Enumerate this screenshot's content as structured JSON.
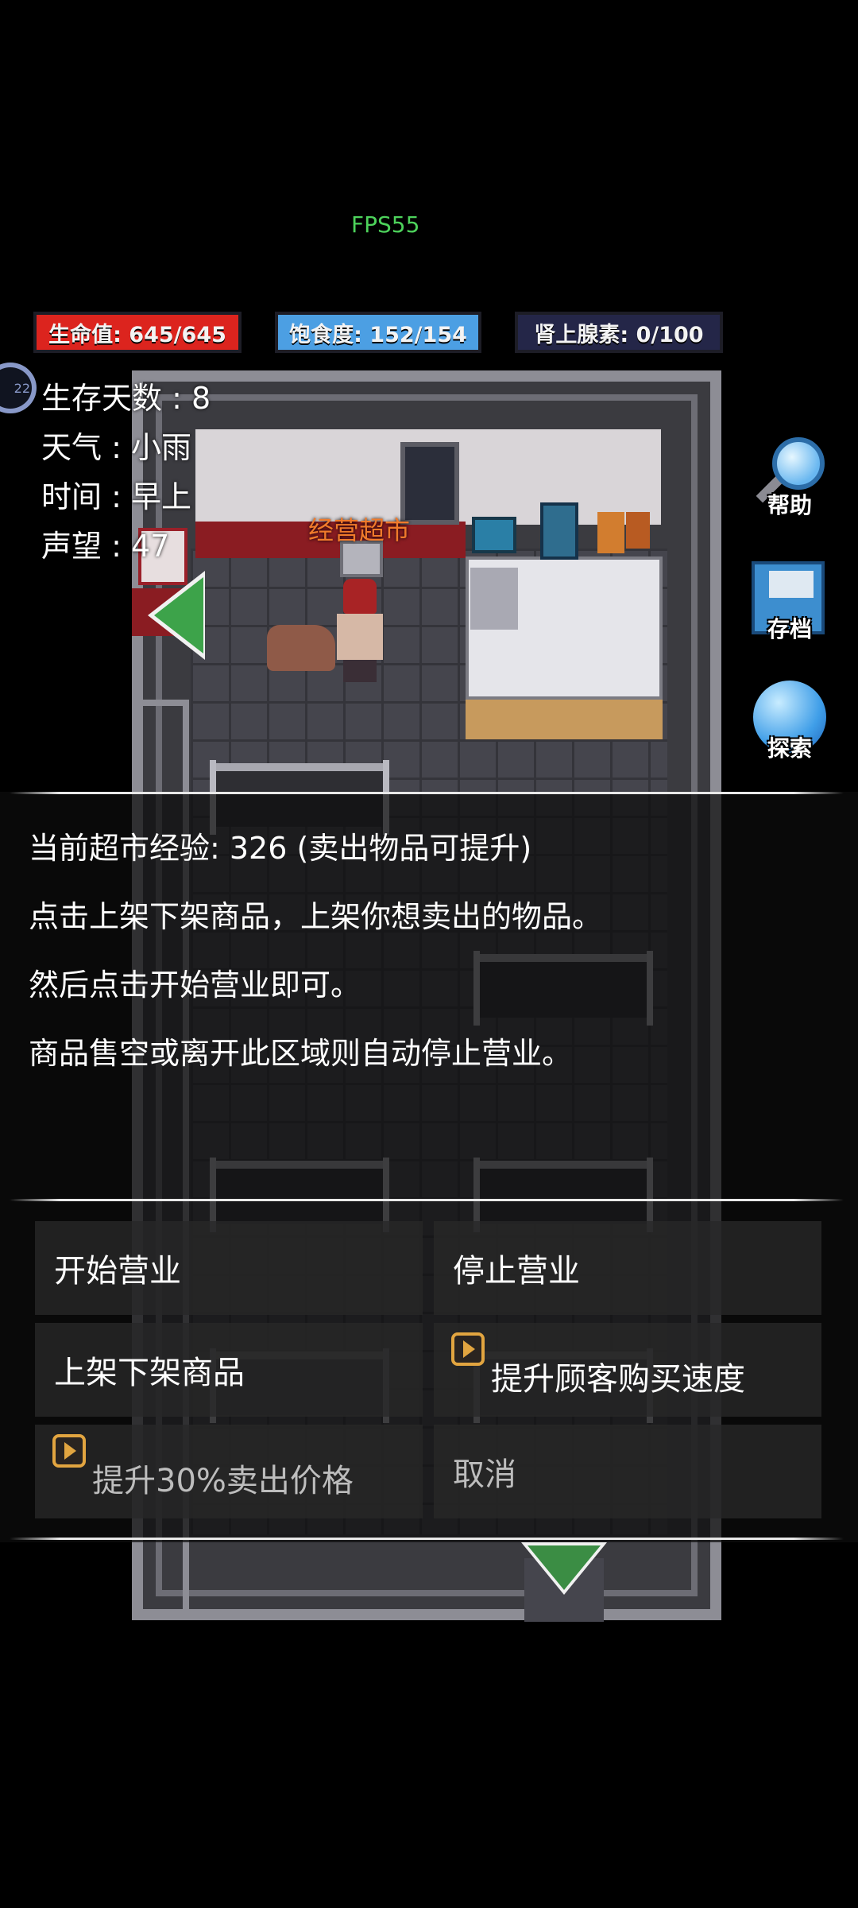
{
  "hud": {
    "fps": "FPS55",
    "health_label": "生命值: 645/645",
    "satiety_label": "饱食度: 152/154",
    "adrenaline_label": "肾上腺素: 0/100",
    "avatar_badge": "22"
  },
  "stats": {
    "days": "生存天数 : 8",
    "weather": "天气 : 小雨",
    "time": "时间 : 早上",
    "reputation": "声望 : 47"
  },
  "side_buttons": {
    "help": "帮助",
    "save": "存档",
    "explore": "探索"
  },
  "map": {
    "npc_label": "经营超市"
  },
  "dialog": {
    "lines": [
      "当前超市经验: 326 (卖出物品可提升)",
      "点击上架下架商品，上架你想卖出的物品。",
      "然后点击开始营业即可。",
      "商品售空或离开此区域则自动停止营业。"
    ],
    "options": {
      "start": "开始营业",
      "stop": "停止营业",
      "shelve": "上架下架商品",
      "speed_up": "提升顾客购买速度",
      "price_up": "提升30%卖出价格",
      "cancel": "取消"
    }
  },
  "colors": {
    "health": "#dc241e",
    "satiety": "#4c9fe3",
    "adrenaline": "#242648",
    "fps": "#4dd25b",
    "npc_label": "#f07a2b",
    "ad_icon": "#e2a540"
  }
}
